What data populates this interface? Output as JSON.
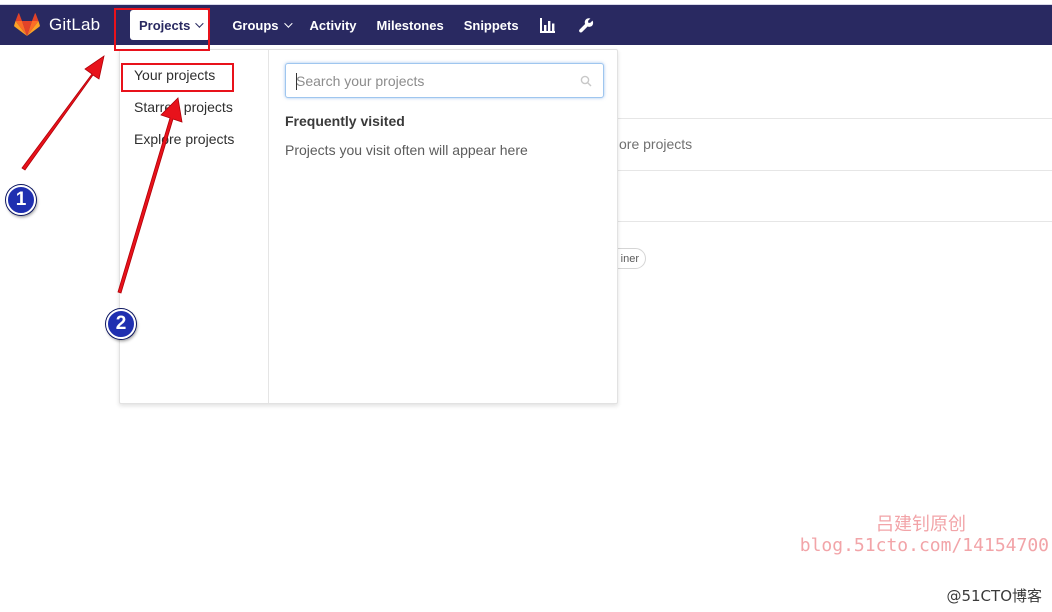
{
  "app": {
    "brand": "GitLab"
  },
  "navbar": {
    "projects_label": "Projects",
    "groups_label": "Groups",
    "activity_label": "Activity",
    "milestones_label": "Milestones",
    "snippets_label": "Snippets",
    "chart_icon": "chart-bar-icon",
    "admin_icon": "wrench-icon",
    "background_color": "#292961"
  },
  "dropdown": {
    "links": [
      {
        "label": "Your projects"
      },
      {
        "label": "Starred projects"
      },
      {
        "label": "Explore projects"
      }
    ],
    "search": {
      "placeholder": "Search your projects",
      "value": ""
    },
    "frequently_visited_title": "Frequently visited",
    "frequently_visited_empty": "Projects you visit often will appear here"
  },
  "background_page": {
    "partial_text": "ore projects",
    "partial_badge": "iner"
  },
  "annotations": {
    "marker_1": "1",
    "marker_2": "2",
    "highlight_color": "#e8121b"
  },
  "watermark": {
    "line1": "吕建钊原创",
    "line2": "blog.51cto.com/14154700",
    "corner": "@51CTO博客"
  }
}
